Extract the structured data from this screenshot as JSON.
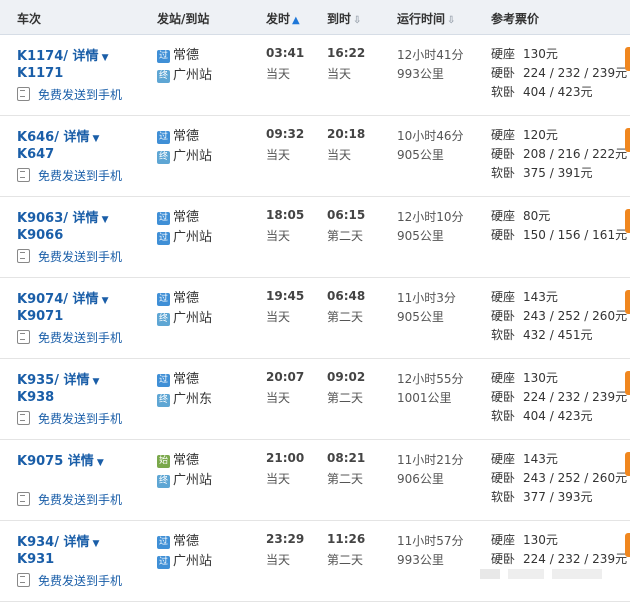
{
  "header": {
    "train": "车次",
    "stations": "发站/到站",
    "depart": "发时",
    "arrive": "到时",
    "duration": "运行时间",
    "fare": "参考票价"
  },
  "sort_icons": {
    "depart": "sort-asc-icon",
    "arrive": "sort-desc-icon",
    "duration": "sort-desc-icon"
  },
  "badge_colors": {
    "pass": "#3f8fd6",
    "origin": "#7aa84b",
    "terminal": "#5ea6d4"
  },
  "sms_label": "免费发送到手机",
  "trains": [
    {
      "code1": "K1174/",
      "details": "详情",
      "code2": "K1171",
      "from_badge": "过",
      "from_badge_type": "pass",
      "from": "常德",
      "to_badge": "终",
      "to_badge_type": "terminal",
      "to": "广州站",
      "dep": "03:41",
      "dep_day": "当天",
      "arr": "16:22",
      "arr_day": "当天",
      "dur": "12小时41分",
      "dist": "993公里",
      "fares": [
        {
          "type": "硬座",
          "price": "130元"
        },
        {
          "type": "硬卧",
          "price": "224 / 232 / 239元"
        },
        {
          "type": "软卧",
          "price": "404 / 423元"
        }
      ]
    },
    {
      "code1": "K646/",
      "details": "详情",
      "code2": "K647",
      "from_badge": "过",
      "from_badge_type": "pass",
      "from": "常德",
      "to_badge": "终",
      "to_badge_type": "terminal",
      "to": "广州站",
      "dep": "09:32",
      "dep_day": "当天",
      "arr": "20:18",
      "arr_day": "当天",
      "dur": "10小时46分",
      "dist": "905公里",
      "fares": [
        {
          "type": "硬座",
          "price": "120元"
        },
        {
          "type": "硬卧",
          "price": "208 / 216 / 222元"
        },
        {
          "type": "软卧",
          "price": "375 / 391元"
        }
      ]
    },
    {
      "code1": "K9063/",
      "details": "详情",
      "code2": "K9066",
      "from_badge": "过",
      "from_badge_type": "pass",
      "from": "常德",
      "to_badge": "过",
      "to_badge_type": "pass",
      "to": "广州站",
      "dep": "18:05",
      "dep_day": "当天",
      "arr": "06:15",
      "arr_day": "第二天",
      "dur": "12小时10分",
      "dist": "905公里",
      "fares": [
        {
          "type": "硬座",
          "price": "80元"
        },
        {
          "type": "硬卧",
          "price": "150 / 156 / 161元"
        }
      ]
    },
    {
      "code1": "K9074/",
      "details": "详情",
      "code2": "K9071",
      "from_badge": "过",
      "from_badge_type": "pass",
      "from": "常德",
      "to_badge": "终",
      "to_badge_type": "terminal",
      "to": "广州站",
      "dep": "19:45",
      "dep_day": "当天",
      "arr": "06:48",
      "arr_day": "第二天",
      "dur": "11小时3分",
      "dist": "905公里",
      "fares": [
        {
          "type": "硬座",
          "price": "143元"
        },
        {
          "type": "硬卧",
          "price": "243 / 252 / 260元"
        },
        {
          "type": "软卧",
          "price": "432 / 451元"
        }
      ]
    },
    {
      "code1": "K935/",
      "details": "详情",
      "code2": "K938",
      "from_badge": "过",
      "from_badge_type": "pass",
      "from": "常德",
      "to_badge": "终",
      "to_badge_type": "terminal",
      "to": "广州东",
      "dep": "20:07",
      "dep_day": "当天",
      "arr": "09:02",
      "arr_day": "第二天",
      "dur": "12小时55分",
      "dist": "1001公里",
      "fares": [
        {
          "type": "硬座",
          "price": "130元"
        },
        {
          "type": "硬卧",
          "price": "224 / 232 / 239元"
        },
        {
          "type": "软卧",
          "price": "404 / 423元"
        }
      ]
    },
    {
      "code1": "K9075",
      "details": "详情",
      "code2": "",
      "from_badge": "始",
      "from_badge_type": "origin",
      "from": "常德",
      "to_badge": "终",
      "to_badge_type": "terminal",
      "to": "广州站",
      "dep": "21:00",
      "dep_day": "当天",
      "arr": "08:21",
      "arr_day": "第二天",
      "dur": "11小时21分",
      "dist": "906公里",
      "fares": [
        {
          "type": "硬座",
          "price": "143元"
        },
        {
          "type": "硬卧",
          "price": "243 / 252 / 260元"
        },
        {
          "type": "软卧",
          "price": "377 / 393元"
        }
      ]
    },
    {
      "code1": "K934/",
      "details": "详情",
      "code2": "K931",
      "from_badge": "过",
      "from_badge_type": "pass",
      "from": "常德",
      "to_badge": "过",
      "to_badge_type": "pass",
      "to": "广州站",
      "dep": "23:29",
      "dep_day": "当天",
      "arr": "11:26",
      "arr_day": "第二天",
      "dur": "11小时57分",
      "dist": "993公里",
      "fares": [
        {
          "type": "硬座",
          "price": "130元"
        },
        {
          "type": "硬卧",
          "price": "224 / 232 / 239元"
        }
      ]
    }
  ]
}
